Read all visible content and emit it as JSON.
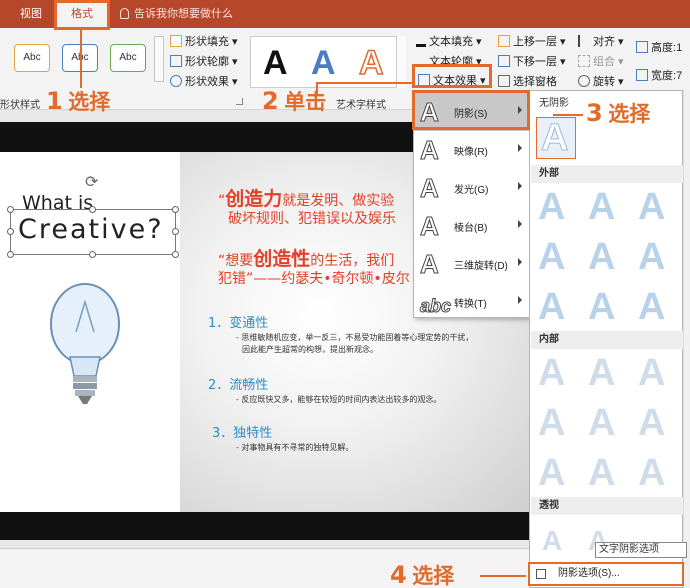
{
  "tabs": [
    {
      "label": "视图",
      "active": false
    },
    {
      "label": "格式",
      "active": true
    }
  ],
  "tell_me": "告诉我你想要做什么",
  "shape_styles": {
    "samples": [
      "Abc",
      "Abc",
      "Abc"
    ],
    "fill": "形状填充",
    "outline": "形状轮廓",
    "effects": "形状效果",
    "group_label": "形状样式"
  },
  "wordart": {
    "samples": [
      "A",
      "A",
      "A"
    ],
    "text_fill": "文本填充",
    "text_outline": "文本轮廓",
    "text_effects": "文本效果",
    "group_label": "艺术字样式"
  },
  "arrange": {
    "bring_forward": "上移一层",
    "send_backward": "下移一层",
    "selection_pane": "选择窗格",
    "align": "对齐",
    "group": "组合",
    "rotate": "旋转"
  },
  "size": {
    "height_label": "高度:",
    "height_value": "1",
    "width_label": "宽度:",
    "width_value": "7"
  },
  "effects_menu": [
    {
      "label": "阴影(S)",
      "highlighted": true
    },
    {
      "label": "映像(R)",
      "highlighted": false
    },
    {
      "label": "发光(G)",
      "highlighted": false
    },
    {
      "label": "棱台(B)",
      "highlighted": false
    },
    {
      "label": "三维旋转(D)",
      "highlighted": false
    },
    {
      "label": "转换(T)",
      "highlighted": false
    }
  ],
  "shadow_gallery": {
    "no_shadow": "无阴影",
    "outer": "外部",
    "inner": "内部",
    "perspective": "透视",
    "tooltip": "文字阴影选项",
    "options": "阴影选项(S)..."
  },
  "slide": {
    "title_line1": "What is",
    "title_line2": "Creative?",
    "quote1_a": "“",
    "quote1_big": "创造力",
    "quote1_b": "就是发明、做实验",
    "quote1_line2": "破坏规则、犯错误以及娱乐",
    "quote2_a": "“想要",
    "quote2_big": "创造性",
    "quote2_b": "的生活，我们",
    "quote2_line2": "犯错”——约瑟夫•奇尔顿•皮尔",
    "sections": [
      {
        "title": "1．变通性",
        "desc": [
          "- 思维敏随机应变，举一反三，不易受功能固着等心理定势的干扰，",
          "因此能产生超常的构想，提出新观念。"
        ]
      },
      {
        "title": "2．流畅性",
        "desc": [
          "- 反应既快又多，能够在较短的时间内表达出较多的观念。"
        ]
      },
      {
        "title": "3．独特性",
        "desc": [
          "- 对事物具有不寻常的独特见解。"
        ]
      }
    ]
  },
  "annotations": [
    {
      "num": "1",
      "text": "选择"
    },
    {
      "num": "2",
      "text": "单击"
    },
    {
      "num": "3",
      "text": "选择"
    },
    {
      "num": "4",
      "text": "选择"
    }
  ],
  "colors": {
    "ribbon_accent": "#b7472a",
    "annotation": "#e26b2c",
    "quote_red": "#e2402a",
    "section_blue": "#2b8fc3"
  }
}
